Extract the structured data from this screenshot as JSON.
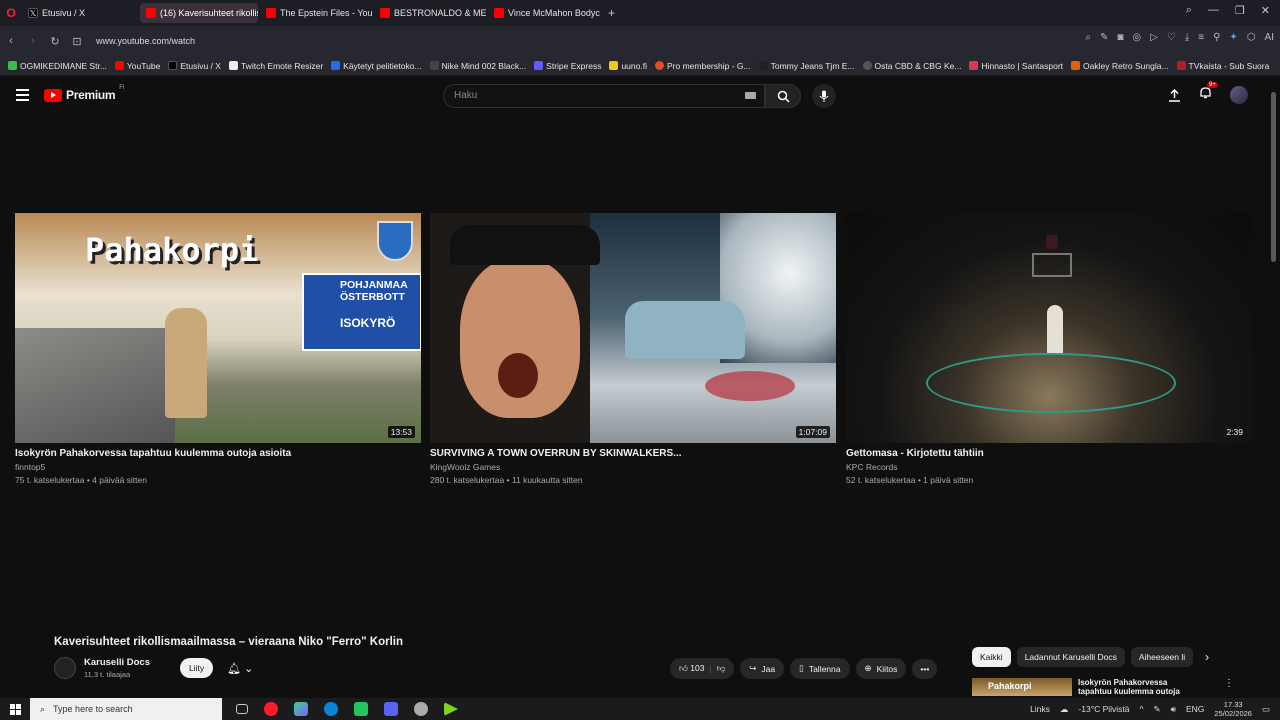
{
  "browser": {
    "tabs": [
      {
        "label": "Etusivu / X",
        "icon": "x-icon",
        "active": false
      },
      {
        "label": "(16) Kaverisuhteet rikollis",
        "icon": "youtube-icon",
        "active": true
      },
      {
        "label": "The Epstein Files - YouTu",
        "icon": "youtube-icon",
        "active": false
      },
      {
        "label": "BESTRONALDO & MESSI",
        "icon": "youtube-icon",
        "active": false
      },
      {
        "label": "Vince McMahon Bodycam",
        "icon": "youtube-icon",
        "active": false
      }
    ],
    "new_tab": "+",
    "url": "www.youtube.com/watch",
    "ai_label": "AI",
    "bookmarks": [
      {
        "label": "OGMIKEDIMANE Str...",
        "color": "#3fb950"
      },
      {
        "label": "YouTube",
        "color": "#ff0000"
      },
      {
        "label": "Etusivu / X",
        "color": "#000000"
      },
      {
        "label": "Twitch Emote Resizer",
        "color": "#9146ff"
      },
      {
        "label": "Käytetyt pelitietoko...",
        "color": "#1f6feb"
      },
      {
        "label": "Nike Mind 002 Black...",
        "color": "#444444"
      },
      {
        "label": "Stripe Express",
        "color": "#635bff"
      },
      {
        "label": "uuno.fi",
        "color": "#f2c811"
      },
      {
        "label": "Pro membership - G...",
        "color": "#e34c26"
      },
      {
        "label": "Tommy Jeans Tjm E...",
        "color": "#222222"
      },
      {
        "label": "Osta CBD & CBG Ke...",
        "color": "#555555"
      },
      {
        "label": "Hinnasto | Santasport",
        "color": "#d73a49"
      },
      {
        "label": "Oakley Retro Sungla...",
        "color": "#e36209"
      },
      {
        "label": "TVkaista - Sub Suora",
        "color": "#b31d28"
      }
    ]
  },
  "youtube": {
    "logo_text": "Premium",
    "logo_region": "FI",
    "search_placeholder": "Haku",
    "notification_count": "9+",
    "endscreen": [
      {
        "title": "Isokyrön Pahakorvessa tapahtuu kuulemma outoja asioita",
        "channel": "finntop5",
        "views": "75 t. katselukertaa",
        "age": "4 päivää sitten",
        "duration": "13:53",
        "thumb_text": "Pahakorpi",
        "sign1": "POHJANMAA ÖSTERBOTT",
        "sign2": "ISOKYRÖ"
      },
      {
        "title": "SURVIVING A TOWN OVERRUN BY SKINWALKERS...",
        "channel": "KingWoolz Games",
        "views": "280 t. katselukertaa",
        "age": "11 kuukautta sitten",
        "duration": "1:07:09"
      },
      {
        "title": "Gettomasa - Kirjotettu tähtiin",
        "channel": "KPC Records",
        "views": "52 t. katselukertaa",
        "age": "1 päivä sitten",
        "duration": "2:39"
      }
    ],
    "video": {
      "title": "Kaverisuhteet rikollismaailmassa – vieraana Niko \"Ferro\" Korlin",
      "channel": "Karuselli Docs",
      "subscribers": "11,3 t. tilaajaa",
      "join_label": "Liity",
      "likes": "103",
      "share_label": "Jaa",
      "save_label": "Tallenna",
      "thanks_label": "Kiitos"
    },
    "chips": [
      "Kaikki",
      "Ladannut Karuselli Docs",
      "Aiheeseen li"
    ],
    "side_video": {
      "thumb_text": "Pahakorpi",
      "title": "Isokyrön Pahakorvessa tapahtuu kuulemma outoja"
    }
  },
  "taskbar": {
    "search_placeholder": "Type here to search",
    "links_label": "Links",
    "weather": "-13°C  Pilvistä",
    "lang": "ENG",
    "time": "17.33",
    "date": "25/02/2026"
  }
}
